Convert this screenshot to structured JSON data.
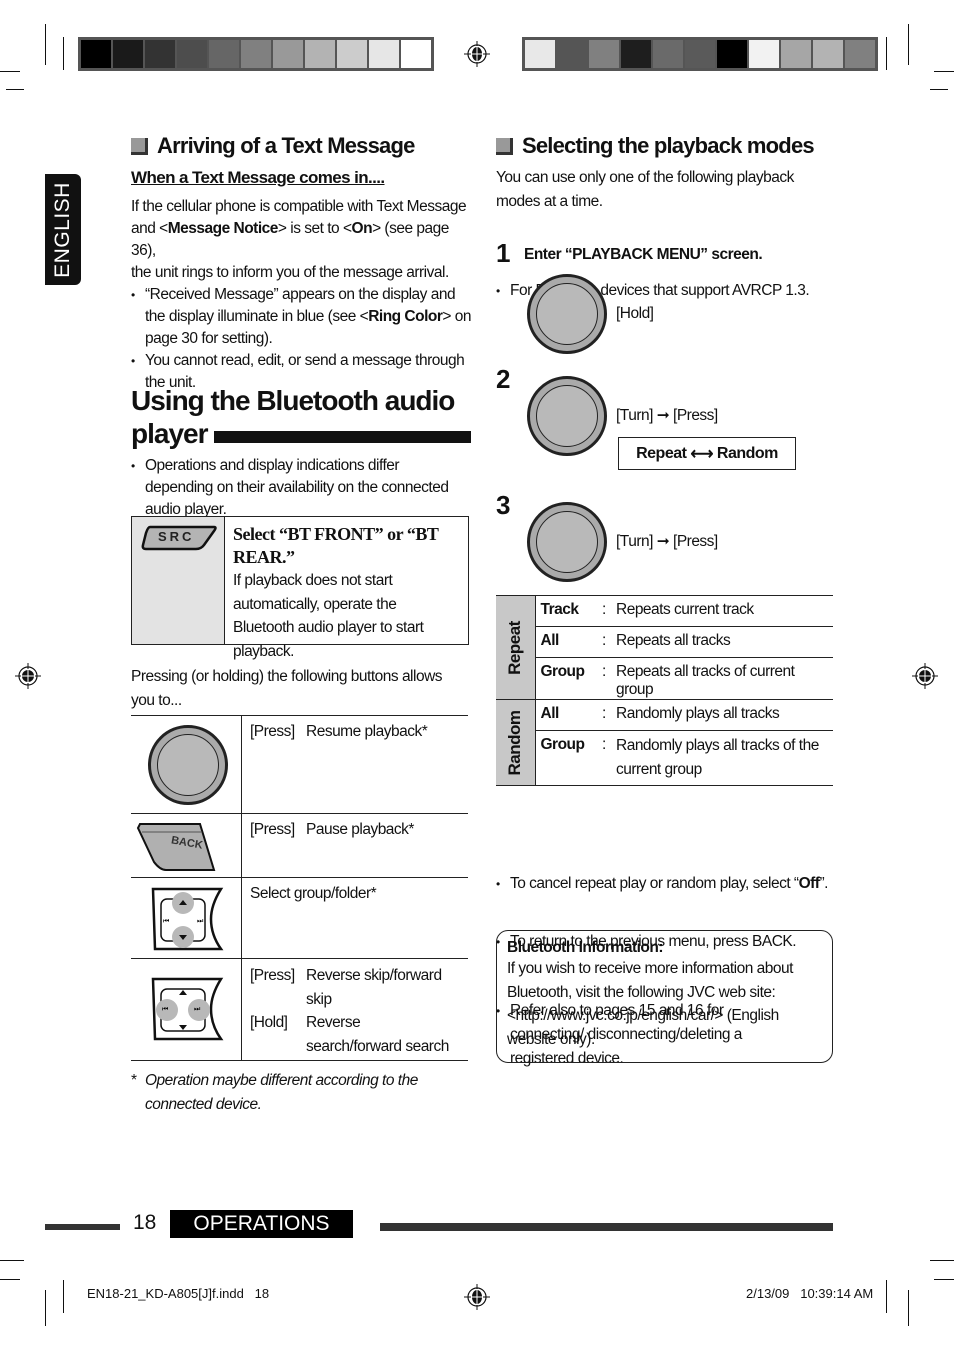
{
  "print_marks": {
    "color_bar_left": [
      "#000000",
      "#1a1a1a",
      "#333333",
      "#4d4d4d",
      "#666666",
      "#808080",
      "#999999",
      "#b3b3b3",
      "#cccccc",
      "#e6e6e6",
      "#ffffff"
    ],
    "color_bar_right": [
      "#e8e8e8",
      "#555555",
      "#808080",
      "#1e1e1e",
      "#6a6a6a",
      "#5a5a5a",
      "#000000",
      "#f2f2f2",
      "#a6a6a6",
      "#b3b3b3",
      "#808080"
    ]
  },
  "language_tab": "ENGLISH",
  "left": {
    "text_message": {
      "heading": "Arriving of a Text Message",
      "subheading": "When a Text Message comes in....",
      "intro_1": "If the cellular phone is compatible with Text Message",
      "intro_2a": "and <",
      "intro_2b": "Message Notice",
      "intro_2c": "> is set to <",
      "intro_2d": "On",
      "intro_2e": "> (see page 36),",
      "intro_3": "the unit rings to inform you of the message arrival.",
      "bullet_1a": "“Received Message” appears on the display and the display illuminate in blue (see <",
      "bullet_1b": "Ring Color",
      "bullet_1c": "> on page 30 for setting).",
      "bullet_2": "You cannot read, edit, or send a message through the unit."
    },
    "bt_audio": {
      "title_line1": "Using the Bluetooth audio",
      "title_line2": "player",
      "bullet": "Operations and display indications differ depending on their availability on the connected audio player.",
      "src_label": "SRC",
      "select_title": "Select “BT FRONT” or “BT REAR.”",
      "select_body": "If playback does not start automatically, operate the Bluetooth audio player to start playback.",
      "pressing_intro": "Pressing (or holding) the following buttons allows you to...",
      "controls": [
        {
          "icon": "control-knob",
          "rows": [
            {
              "action": "[Press]",
              "desc": "Resume playback*"
            }
          ]
        },
        {
          "icon": "back-button",
          "button_label": "BACK",
          "rows": [
            {
              "action": "[Press]",
              "desc": "Pause playback*"
            }
          ]
        },
        {
          "icon": "up-down-pad",
          "rows": [
            {
              "action": "",
              "desc": "Select group/folder*"
            }
          ]
        },
        {
          "icon": "left-right-pad",
          "rows": [
            {
              "action": "[Press]",
              "desc": "Reverse skip/forward skip"
            },
            {
              "action": "[Hold]",
              "desc": "Reverse search/forward search"
            }
          ]
        }
      ],
      "footnote_mark": "*",
      "footnote": "Operation maybe different according to the connected device."
    }
  },
  "right": {
    "heading": "Selecting the playback modes",
    "intro": "You can use only one of the following playback modes at a time.",
    "bullet": "For Bluetooth devices that support AVRCP 1.3.",
    "steps": [
      {
        "num": "1",
        "title": "Enter “PLAYBACK MENU” screen.",
        "action": "[Hold]"
      },
      {
        "num": "2",
        "action": "[Turn] ➞ [Press]",
        "option_a": "Repeat",
        "option_b": "Random"
      },
      {
        "num": "3",
        "action": "[Turn] ➞ [Press]"
      }
    ],
    "modes": [
      {
        "group": "Repeat",
        "items": [
          {
            "key": "Track",
            "desc": "Repeats current track"
          },
          {
            "key": "All",
            "desc": "Repeats all tracks"
          },
          {
            "key": "Group",
            "desc": "Repeats all tracks of current group"
          }
        ]
      },
      {
        "group": "Random",
        "items": [
          {
            "key": "All",
            "desc": "Randomly plays all tracks"
          },
          {
            "key": "Group",
            "desc": "Randomly plays all tracks of the current group"
          }
        ]
      }
    ],
    "note_cancel_a": "To cancel repeat play or random play, select “",
    "note_cancel_b": "Off",
    "note_cancel_c": "”.",
    "note_back": "To return to the previous menu, press BACK.",
    "note_refer": "Refer also to pages 15 and 16 for connecting/ disconnecting/deleting a registered device.",
    "info_title": "Bluetooth Information:",
    "info_body": "If you wish to receive more information about Bluetooth, visit the following JVC web site: <http://www.jvc.co.jp/english/car/> (English website only)."
  },
  "footer": {
    "page_number": "18",
    "section": "OPERATIONS",
    "file_name": "EN18-21_KD-A805[J]f.indd   18",
    "timestamp": "2/13/09   10:39:14 AM"
  }
}
